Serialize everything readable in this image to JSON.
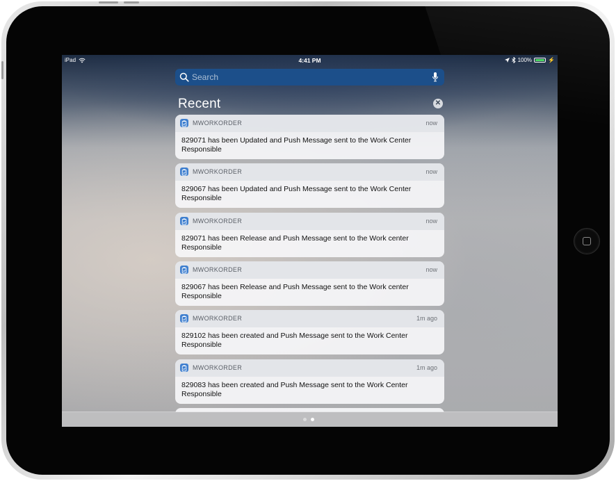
{
  "status_bar": {
    "device": "iPad",
    "time": "4:41 PM",
    "battery": "100%",
    "icons": [
      "wifi-icon",
      "location-icon",
      "bluetooth-icon",
      "battery-icon",
      "charging-icon"
    ],
    "battery_level": 1.0
  },
  "search": {
    "placeholder": "Search"
  },
  "section": {
    "title": "Recent"
  },
  "notifications": [
    {
      "app": "MWORKORDER",
      "time": "now",
      "message": "829071 has been Updated and Push Message sent to the Work Center Responsible"
    },
    {
      "app": "MWORKORDER",
      "time": "now",
      "message": "829067 has been Updated and Push Message sent to the Work Center Responsible"
    },
    {
      "app": "MWORKORDER",
      "time": "now",
      "message": "829071 has been Release and Push Message sent to the Work center Responsible"
    },
    {
      "app": "MWORKORDER",
      "time": "now",
      "message": "829067 has been Release and Push Message sent to the Work center Responsible"
    },
    {
      "app": "MWORKORDER",
      "time": "1m ago",
      "message": "829102 has been created and Push Message sent to the Work Center Responsible"
    },
    {
      "app": "MWORKORDER",
      "time": "1m ago",
      "message": "829083 has been created and Push Message sent to the Work Center Responsible"
    }
  ],
  "page_indicator": {
    "pages": 2,
    "current": 2
  },
  "colors": {
    "search_bar": "#1c4f8a",
    "app_icon": "#3f7fcf",
    "battery_fill": "#4cd964"
  }
}
